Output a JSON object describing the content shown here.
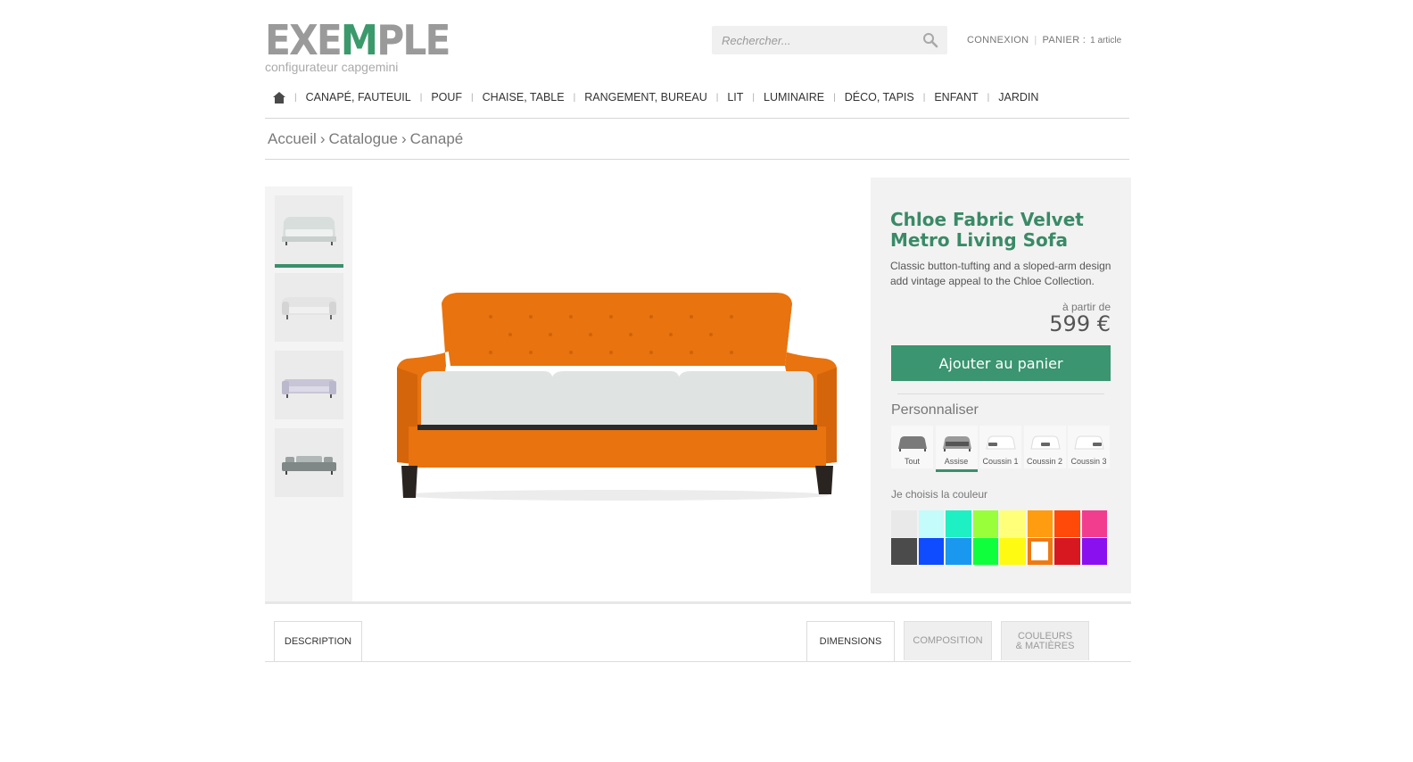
{
  "header": {
    "logo": {
      "part1": "EXE",
      "part2": "M",
      "part3": "PLE"
    },
    "logo_subtitle": "configurateur capgemini",
    "search_placeholder": "Rechercher...",
    "login": "CONNEXION",
    "cart_label": "PANIER :",
    "cart_count": "1 article"
  },
  "nav": {
    "home_icon": "home-icon",
    "items": [
      "CANAPÉ, FAUTEUIL",
      "POUF",
      "CHAISE, TABLE",
      "RANGEMENT, BUREAU",
      "LIT",
      "LUMINAIRE",
      "DÉCO, TAPIS",
      "ENFANT",
      "JARDIN"
    ]
  },
  "breadcrumb": [
    "Accueil",
    "Catalogue",
    "Canapé"
  ],
  "product": {
    "title": "Chloe Fabric Velvet Metro Living Sofa",
    "description": "Classic button-tufting and a sloped-arm design add vintage appeal to the Chloe Collection.",
    "price_prefix": "à partir de",
    "price": "599 €",
    "add_to_cart": "Ajouter au panier",
    "frame_color": "#e8730f",
    "cushion_color": "#dfe3e2"
  },
  "customize": {
    "title": "Personnaliser",
    "parts": [
      {
        "label": "Tout",
        "active": false
      },
      {
        "label": "Assise",
        "active": true
      },
      {
        "label": "Coussin 1",
        "active": false
      },
      {
        "label": "Coussin 2",
        "active": false
      },
      {
        "label": "Coussin 3",
        "active": false
      }
    ],
    "color_title": "Je choisis la couleur",
    "colors": [
      "#e9e9e9",
      "#c4fbfb",
      "#1ff0c4",
      "#9aff3b",
      "#ffff7a",
      "#ff9c0f",
      "#ff4a0a",
      "#f23d8f",
      "#4b4b4b",
      "#0f4bff",
      "#1a98f0",
      "#10ff3c",
      "#fffa12",
      "#ef7a12",
      "#d81820",
      "#8a10f0"
    ],
    "selected_color_index": 13
  },
  "thumbnails": {
    "count": 4,
    "active_index": 0
  },
  "tabs": {
    "description": "DESCRIPTION",
    "dimensions": "DIMENSIONS",
    "composition": "COMPOSITION",
    "colors_line1": "COULEURS",
    "colors_line2": "& MATIÈRES"
  }
}
